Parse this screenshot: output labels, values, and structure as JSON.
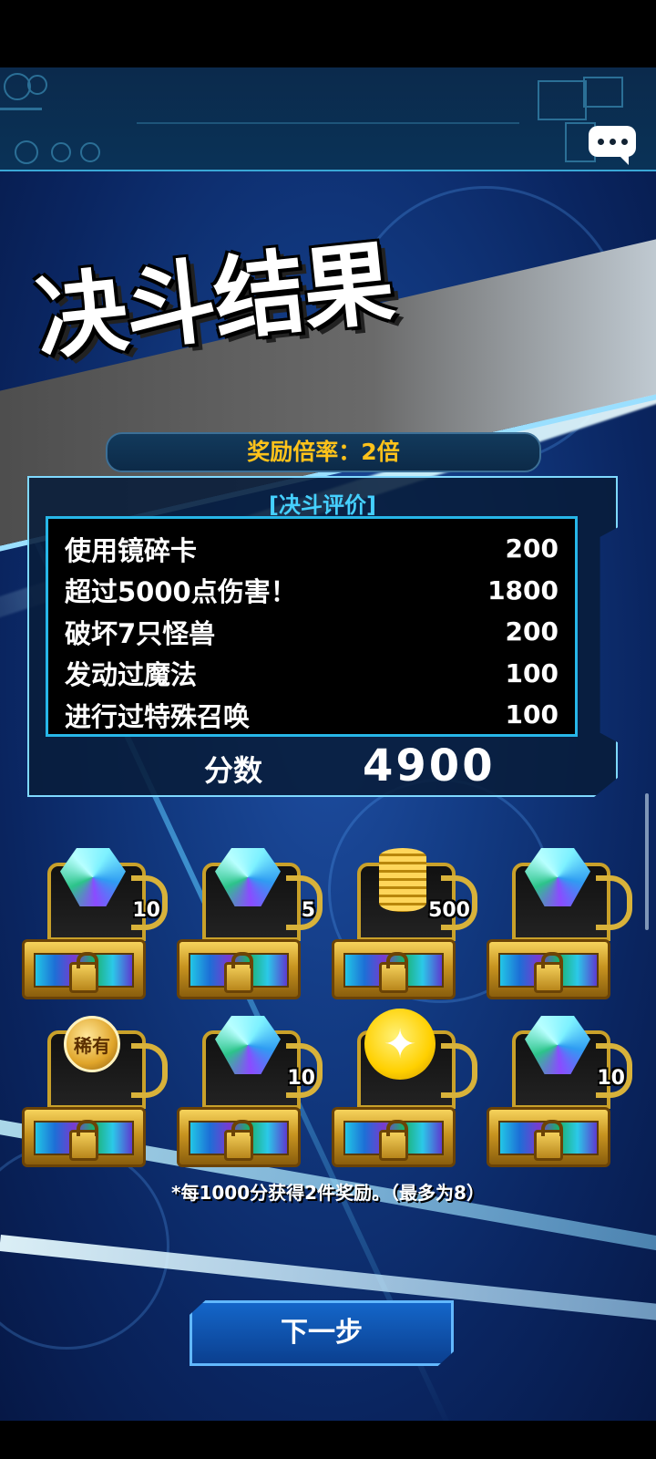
{
  "title": "决斗结果",
  "multiplier": {
    "label": "奖励倍率：2倍"
  },
  "evaluation": {
    "heading": "[决斗评价]",
    "rows": [
      {
        "label": "使用镜碎卡",
        "points": "200"
      },
      {
        "label": "超过5000点伤害！",
        "points": "1800"
      },
      {
        "label": "破坏7只怪兽",
        "points": "200"
      },
      {
        "label": "发动过魔法",
        "points": "100"
      },
      {
        "label": "进行过特殊召唤",
        "points": "100"
      }
    ],
    "score_label": "分数",
    "score_value": "4900"
  },
  "rewards": [
    {
      "item": "gem",
      "quantity": "10"
    },
    {
      "item": "gem",
      "quantity": "5"
    },
    {
      "item": "gold-coins",
      "quantity": "500"
    },
    {
      "item": "gem",
      "quantity": ""
    },
    {
      "item": "rare-medal",
      "badge": "稀有",
      "quantity": ""
    },
    {
      "item": "gem",
      "quantity": "10"
    },
    {
      "item": "star-orb",
      "quantity": ""
    },
    {
      "item": "gem",
      "quantity": "10"
    }
  ],
  "note": "*每1000分获得2件奖励。（最多为8）",
  "next_button": "下一步",
  "icons": {
    "chat": "chat-bubble-icon"
  },
  "colors": {
    "accent_gold": "#ffc21a",
    "heading_cyan": "#45d0ff",
    "frame_cyan": "#27b6e8"
  }
}
